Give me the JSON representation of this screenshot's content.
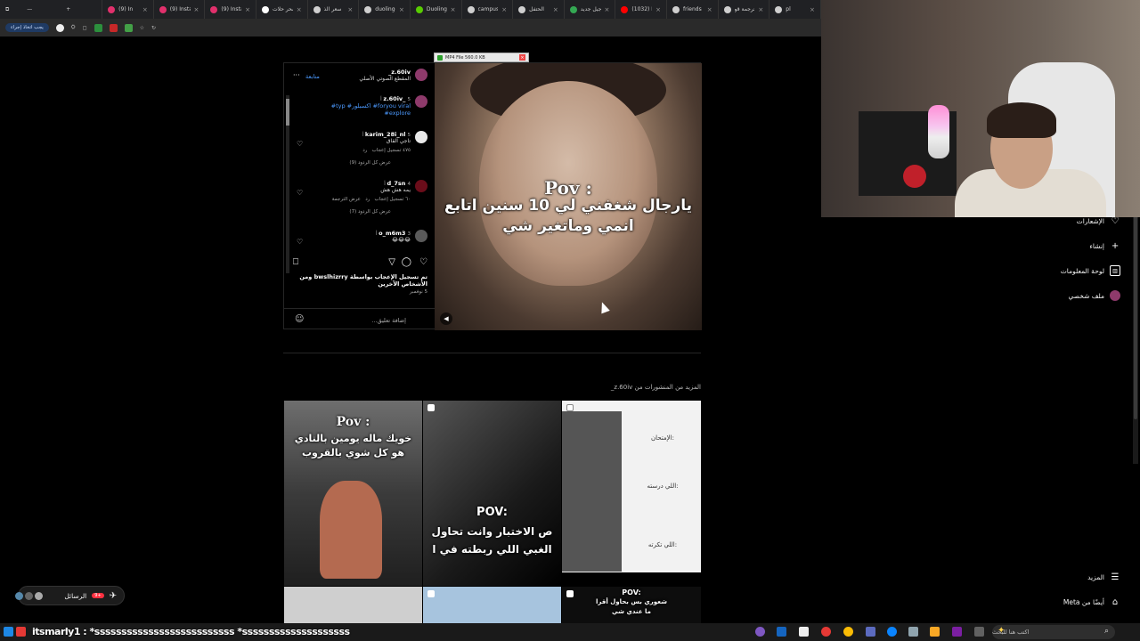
{
  "browser": {
    "tabs": [
      {
        "label": "(9) In",
        "color": "#e1306c"
      },
      {
        "label": "(9) Insta",
        "color": "#e1306c"
      },
      {
        "label": "(9) Insta",
        "color": "#e1306c"
      },
      {
        "label": "سحر حلات",
        "color": "#ffffff"
      },
      {
        "label": "سعر الذ",
        "color": "#cfcfcf"
      },
      {
        "label": "duolingo",
        "color": "#cfcfcf"
      },
      {
        "label": "Duoling",
        "color": "#58cc02"
      },
      {
        "label": "campus",
        "color": "#cfcfcf"
      },
      {
        "label": "الحتفل",
        "color": "#cfcfcf"
      },
      {
        "label": "جيل جديد",
        "color": "#34a853"
      },
      {
        "label": "(1032) ا",
        "color": "#ff0000"
      },
      {
        "label": "friends",
        "color": "#cfcfcf"
      },
      {
        "label": "ترجمة قو",
        "color": "#cfcfcf"
      },
      {
        "label": "pl",
        "color": "#cfcfcf"
      }
    ],
    "update_pill": "يجب اتخاذ إجراء"
  },
  "download_bar": {
    "label": "MP4 File 560.0 KB"
  },
  "post": {
    "author": "z.60iv_",
    "audio": "المقطع الصوتي الأصلي",
    "follow": "متابعة",
    "more": "···",
    "caption_user": "z.60iv_",
    "caption_age": "5 أ",
    "caption_text": "#typ #اكسبلور #foryou viral",
    "caption_text2": "#explore",
    "comments": [
      {
        "user": "karim_28i_nl",
        "age": "5 أ",
        "text": "تاجي القاق",
        "likes": "٤٧٥ تسجيل إعجاب",
        "reply": "رد",
        "translate": "",
        "view_replies": "عرض كل الردود (9)"
      },
      {
        "user": "d_7sn",
        "age": "4 أ",
        "text": "يمه هش هش",
        "likes": "٦٠ تسجيل إعجاب",
        "reply": "رد",
        "translate": "عرض الترجمة",
        "view_replies": "عرض كل الردود (7)"
      },
      {
        "user": "o_m6m3",
        "age": "3 أ",
        "text": "😂😂😂",
        "likes": "",
        "reply": "",
        "translate": "",
        "view_replies": ""
      }
    ],
    "liked_by": "تم تسجيل الإعجاب بواسطة bwslhizrry ومن الأشخاص الآخرين",
    "date": "5 نوفمبر",
    "add_comment_placeholder": "إضافة تعليق..."
  },
  "video": {
    "line1": "Pov :",
    "line2": "يارجال شغفني لي 10 سنين اتابع",
    "line3": "انمي وماتغير شي"
  },
  "more_posts": {
    "label": "المزيد من المنشورات من z.60iv_",
    "tiles": [
      {
        "l1": "Pov :",
        "l2": "خويك ماله يومين بالنادي",
        "l3": "هو كل شوي بالقروب"
      },
      {
        "l1": "POV:",
        "l2": "ص الاختبار وانت تحاول",
        "l3": "الغبي اللي ربطته في ا"
      },
      {
        "l1": "الإمتحان:",
        "l2": "اللي درسته:",
        "l3": "اللي تكرته:"
      },
      {
        "l1": "",
        "l2": "",
        "l3": ""
      },
      {
        "l1": "",
        "l2": "",
        "l3": ""
      },
      {
        "l1": "POV:",
        "l2": "شعوري بس بحاول أقرا",
        "l3": "ما عندي شي"
      }
    ]
  },
  "sidebar": {
    "items": [
      {
        "label": "الإشعارات",
        "icon": "heart-icon"
      },
      {
        "label": "إنشاء",
        "icon": "plus-icon"
      },
      {
        "label": "لوحة المعلومات",
        "icon": "dashboard-icon"
      },
      {
        "label": "ملف شخصي",
        "icon": "profile-icon"
      }
    ],
    "more": "المزيد",
    "also_from_meta": "أيضًا من Meta"
  },
  "messages": {
    "label": "الرسائل",
    "badge": "+9"
  },
  "taskbar": {
    "overlay_text": "itsmarly1 : *ssssssssssssssssssssssssss *ssssssssssssssssssss",
    "search_placeholder": "اكتب هنا للبحث"
  }
}
